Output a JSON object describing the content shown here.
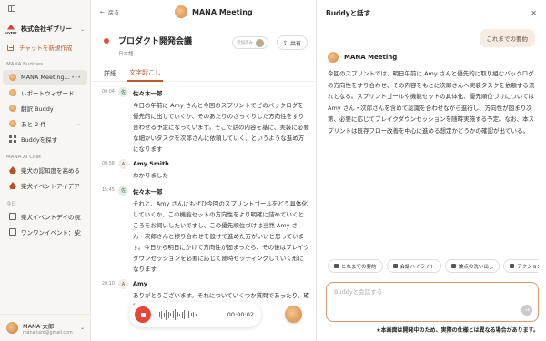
{
  "sidebar": {
    "org_name": "株式会社ギブリー",
    "org_logo_text": "GIVERY",
    "new_chat_label": "チャットを新規作成",
    "buddies_heading": "MANA Buddies",
    "buddies": [
      {
        "label": "MANA Meeting...",
        "icon": "avatar-icon",
        "active": true
      },
      {
        "label": "レポートウィザード",
        "icon": "avatar-icon",
        "active": false
      },
      {
        "label": "翻訳 Buddy",
        "icon": "avatar-icon",
        "active": false
      },
      {
        "label": "あと 2 件",
        "icon": "avatar-icon",
        "active": false
      },
      {
        "label": "Buddyを探す",
        "icon": "grid-icon",
        "active": false
      }
    ],
    "ai_chat_heading": "MANA AI Chat",
    "ai_chats": [
      {
        "label": "柴犬の認知度を高める"
      },
      {
        "label": "柴犬イベントアイデア"
      }
    ],
    "today_heading": "今日",
    "today": [
      {
        "label": "柴犬イベントデイの視覚と..."
      },
      {
        "label": "ワンワンイベント：柴犬キ..."
      }
    ],
    "user": {
      "name": "MANA 太郎",
      "email": "mana.taro@gmail.com"
    }
  },
  "main": {
    "back_label": "戻る",
    "title": "MANA Meeting",
    "project_title": "プロダクト開発会議",
    "language": "日本語",
    "join_label": "参加済み",
    "share_label": "共有",
    "tabs": [
      {
        "label": "詳細",
        "active": false
      },
      {
        "label": "文字起こし",
        "active": true
      }
    ],
    "entries": [
      {
        "time": "00:04",
        "badge": "佐",
        "speaker": "佐々木一郎",
        "text": "今日の午前に Amy さんと今回のスプリントでどのバックログを優先的に出していくか、そのあたりのざっくりした方向性をすり合わせる予定になっています。そこで話の内容を基に、実装に必要な細かいタスクを次郎さんに依頼していく、というような進め方になります"
      },
      {
        "time": "00:58",
        "badge": "A",
        "speaker": "Amy Smith",
        "text": "わかりました"
      },
      {
        "time": "15:45",
        "badge": "佐",
        "speaker": "佐々木一郎",
        "text": "それと、Amy さんにもぜひ今回のスプリントゴールをどう具体化していくか、この機能セットの方向性をより明確に詰めていくところをお伺いしたいですし、この優先順位づけは当然 Amy さん・次郎さんと擦り合わせを設けて進めた方がいいと思っています。今日から明日にかけて方向性が固まったら、その後はブレイクダウンセッションを必要に応じて随時セッティングしていく形になります"
      },
      {
        "time": "20:10",
        "badge": "A",
        "speaker": "Amy",
        "text": "ありがとうございます。それについていくつか質問であったり、確認事項などはまだまだです"
      }
    ],
    "recorder": {
      "timer": "00:00:02"
    }
  },
  "panel": {
    "title": "Buddyと話す",
    "user_message": "これまでの要約",
    "bot_name": "MANA Meeting",
    "bot_message": "今回のスプリントでは、明日午前に Amy さんと優先的に取り組むバックログの方向性をすり合わせ、その内容をもとに次郎さんへ実装タスクを依頼する流れとなる。スプリントゴールや機能セットの具体化、優先順位づけについては Amy さん・次郎さんを含めて認識を合わせながら進行し、方向性が固まり次第、必要に応じてブレイクダウンセッションを随時実施する予定。なお、本スプリントは既存フロー改善を中心に進める想定かどうかの確認が出ている。",
    "chips": [
      {
        "label": "これまでの要約",
        "icon": "mic-icon"
      },
      {
        "label": "会議ハイライト",
        "icon": "pin-icon"
      },
      {
        "label": "論点の洗い出し",
        "icon": "flag-icon"
      },
      {
        "label": "アクション",
        "icon": "tag-icon"
      }
    ],
    "composer_placeholder": "Buddyと会話する",
    "notice": "★本画面は開発中のため、実際の仕様とは異なる場合があります。"
  },
  "colors": {
    "accent": "#b65b2c",
    "record": "#e5483a"
  }
}
